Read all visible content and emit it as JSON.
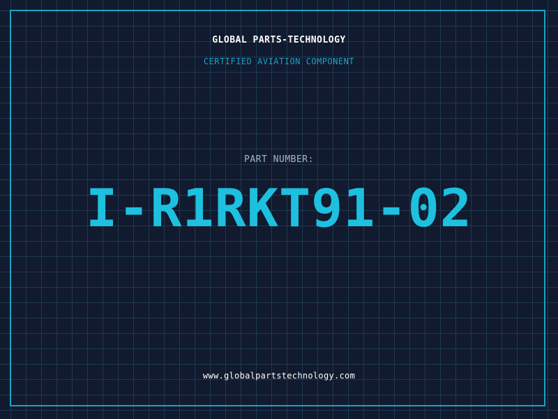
{
  "header": {
    "brand": "GLOBAL PARTS-TECHNOLOGY",
    "subtitle": "CERTIFIED AVIATION COMPONENT"
  },
  "part": {
    "label": "PART NUMBER:",
    "number": "I-R1RKT91-02"
  },
  "footer": {
    "url": "www.globalpartstechnology.com"
  },
  "colors": {
    "background": "#111a2e",
    "grid": "#1e3a52",
    "accent": "#1aa3c8",
    "part_number": "#1ec0e0",
    "text": "#ffffff",
    "label": "#aab4c2"
  }
}
